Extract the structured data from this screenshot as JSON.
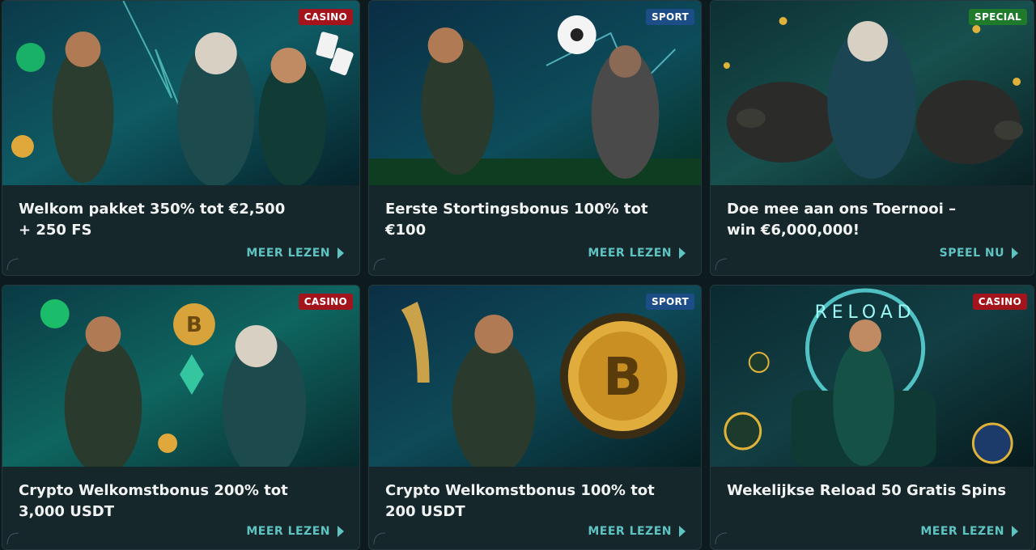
{
  "promotions": [
    {
      "badge": "CASINO",
      "title": "Welkom pakket 350% tot €2,500\n+ 250 FS",
      "title_line1": "Welkom pakket 350% tot €2,500",
      "title_line2": "+ 250 FS",
      "cta": "MEER LEZEN"
    },
    {
      "badge": "SPORT",
      "title_line1": "Eerste Stortingsbonus 100% tot €100",
      "title_line2": "",
      "cta": "MEER LEZEN"
    },
    {
      "badge": "SPECIAL",
      "title_line1": "Doe mee aan ons Toernooi –",
      "title_line2": "win €6,000,000!",
      "cta": "SPEEL NU"
    },
    {
      "badge": "CASINO",
      "title_line1": "Crypto Welkomstbonus 200% tot",
      "title_line2": "3,000 USDT",
      "cta": "MEER LEZEN"
    },
    {
      "badge": "SPORT",
      "title_line1": "Crypto Welkomstbonus 100% tot",
      "title_line2": "200 USDT",
      "cta": "MEER LEZEN"
    },
    {
      "badge": "CASINO",
      "title_line1": "Wekelijkse Reload 50 Gratis Spins",
      "title_line2": "",
      "cta": "MEER LEZEN"
    }
  ],
  "art_text": {
    "reload_sign": "RELOAD",
    "bitcoin_symbol": "B"
  },
  "colors": {
    "casino_badge": "#a4141c",
    "sport_badge": "#1d4d86",
    "special_badge": "#1f7a2c",
    "cta": "#5ec4c2",
    "card_bg": "#16272c"
  }
}
